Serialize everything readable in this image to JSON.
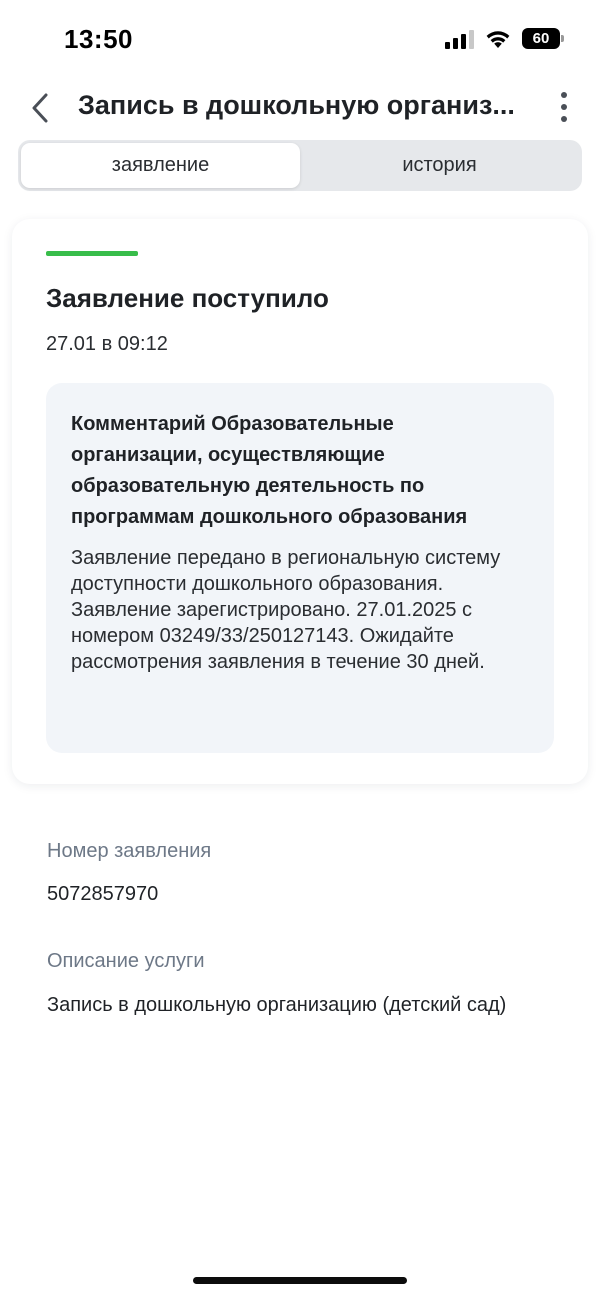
{
  "status_bar": {
    "time": "13:50",
    "battery": "60"
  },
  "header": {
    "back_icon": "chevron-left-icon",
    "title": "Запись в дошкольную организ...",
    "more_icon": "more-vertical-icon"
  },
  "tabs": [
    {
      "label": "заявление",
      "active": true
    },
    {
      "label": "история",
      "active": false
    }
  ],
  "status_card": {
    "accent_color": "#38bd4a",
    "title": "Заявление поступило",
    "date": "27.01 в 09:12",
    "comment_title": "Комментарий Образовательные организации, осуществляющие образовательную деятельность по программам дошкольного образования",
    "comment_text": "Заявление передано в региональную систему доступности дошкольного образования. Заявление зарегистрировано. 27.01.2025 с номером 03249/33/250127143. Ожидайте рассмотрения заявления в течение 30 дней."
  },
  "details": {
    "number_label": "Номер заявления",
    "number_value": "5072857970",
    "service_label": "Описание услуги",
    "service_value": "Запись в дошкольную организацию (детский сад)"
  }
}
